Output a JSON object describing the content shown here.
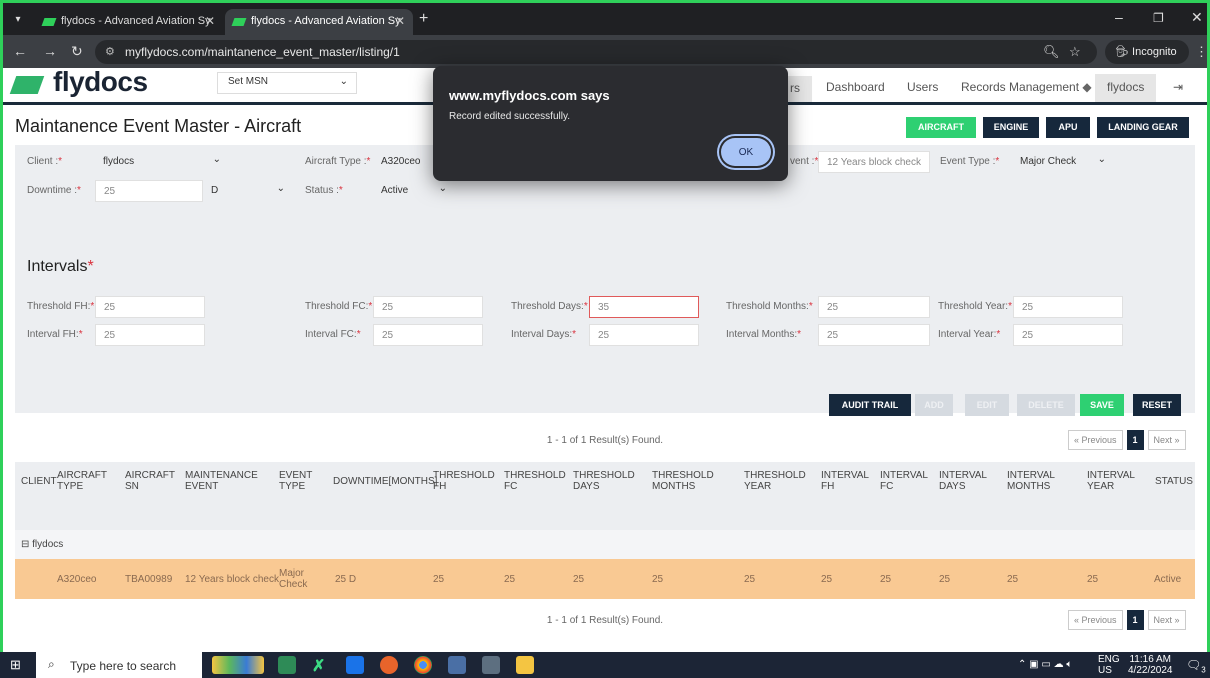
{
  "browser": {
    "tabs": [
      {
        "title": "flydocs - Advanced Aviation Sy",
        "active": false
      },
      {
        "title": "flydocs - Advanced Aviation Sy",
        "active": true
      }
    ],
    "url": "myflydocs.com/maintanence_event_master/listing/1",
    "incognito_label": "Incognito"
  },
  "nav": {
    "logo_text": "flydocs",
    "msn_select": "Set MSN",
    "links": {
      "fragment": "rs",
      "dashboard": "Dashboard",
      "users": "Users",
      "records_management": "Records Management",
      "flydocs": "flydocs"
    }
  },
  "page_title": "Maintanence Event Master - Aircraft",
  "type_buttons": {
    "aircraft": "AIRCRAFT",
    "engine": "ENGINE",
    "apu": "APU",
    "landing_gear": "LANDING GEAR"
  },
  "form": {
    "client_label": "Client :",
    "client_value": "flydocs",
    "aircraft_type_label": "Aircraft Type :",
    "aircraft_type_value": "A320ceo",
    "event_label_fragment": "vent :",
    "event_value": "12 Years block check",
    "event_type_label": "Event Type :",
    "event_type_value": "Major Check",
    "downtime_label": "Downtime :",
    "downtime_value": "25",
    "downtime_unit": "D",
    "status_label": "Status :",
    "status_value": "Active",
    "required_mark": "*"
  },
  "intervals": {
    "title": "Intervals",
    "threshold_fh_label": "Threshold FH:",
    "threshold_fh": "25",
    "threshold_fc_label": "Threshold FC:",
    "threshold_fc": "25",
    "threshold_days_label": "Threshold Days:",
    "threshold_days": "35",
    "threshold_months_label": "Threshold Months:",
    "threshold_months": "25",
    "threshold_year_label": "Threshold Year:",
    "threshold_year": "25",
    "interval_fh_label": "Interval FH:",
    "interval_fh": "25",
    "interval_fc_label": "Interval FC:",
    "interval_fc": "25",
    "interval_days_label": "Interval Days:",
    "interval_days": "25",
    "interval_months_label": "Interval Months:",
    "interval_months": "25",
    "interval_year_label": "Interval Year:",
    "interval_year": "25"
  },
  "actions": {
    "audit_trail": "AUDIT TRAIL",
    "add": "ADD",
    "edit": "EDIT",
    "delete": "DELETE",
    "save": "SAVE",
    "reset": "RESET"
  },
  "results": {
    "count_text": "1 - 1 of 1 Result(s) Found.",
    "prev": "« Previous",
    "page": "1",
    "next": "Next »"
  },
  "table": {
    "headers": {
      "client": "CLIENT",
      "aircraft_type": "AIRCRAFT TYPE",
      "aircraft_sn": "AIRCRAFT SN",
      "maintenance_event": "MAINTENANCE EVENT",
      "event_type": "EVENT TYPE",
      "downtime": "DOWNTIME[MONTHS]",
      "threshold_fh": "THRESHOLD FH",
      "threshold_fc": "THRESHOLD FC",
      "threshold_days": "THRESHOLD DAYS",
      "threshold_months": "THRESHOLD MONTHS",
      "threshold_year": "THRESHOLD YEAR",
      "interval_fh": "INTERVAL FH",
      "interval_fc": "INTERVAL FC",
      "interval_days": "INTERVAL DAYS",
      "interval_months": "INTERVAL MONTHS",
      "interval_year": "INTERVAL YEAR",
      "status": "STATUS"
    },
    "group": "⊟ flydocs",
    "row": {
      "aircraft_type": "A320ceo",
      "aircraft_sn": "TBA00989",
      "maintenance_event": "12 Years block check",
      "event_type": "Major Check",
      "downtime": "25 D",
      "threshold_fh": "25",
      "threshold_fc": "25",
      "threshold_days": "25",
      "threshold_months": "25",
      "threshold_year": "25",
      "interval_fh": "25",
      "interval_fc": "25",
      "interval_days": "25",
      "interval_months": "25",
      "interval_year": "25",
      "status": "Active"
    }
  },
  "dialog": {
    "title": "www.myflydocs.com says",
    "message": "Record edited successfully.",
    "ok": "OK"
  },
  "taskbar": {
    "search_placeholder": "Type here to search",
    "lang": "ENG",
    "region": "US",
    "time": "11:16 AM",
    "date": "4/22/2024",
    "notification_count": "3"
  },
  "colors": {
    "accent_green": "#2ed072",
    "navy": "#16283c",
    "row_highlight": "#f9c993",
    "invalid_border": "#e05a5a"
  }
}
